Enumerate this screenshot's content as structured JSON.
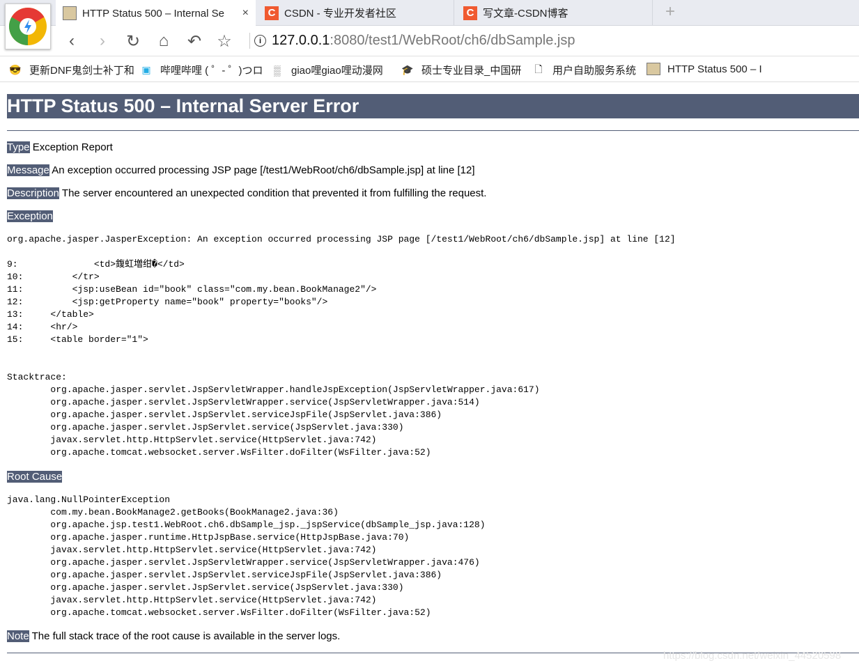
{
  "browser": {
    "tabs": [
      {
        "title": "HTTP Status 500 – Internal Se",
        "icon": "tomcat-icon",
        "active": true
      },
      {
        "title": "CSDN - 专业开发者社区",
        "icon": "csdn-icon"
      },
      {
        "title": "写文章-CSDN博客",
        "icon": "csdn-icon"
      }
    ],
    "new_tab": "+",
    "close": "×",
    "url": {
      "host": "127.0.0.1",
      "rest": ":8080/test1/WebRoot/ch6/dbSample.jsp"
    },
    "bookmarks": [
      {
        "label": "更新DNF鬼剑士补丁和"
      },
      {
        "label": "哔哩哔哩 ( ゜- ゜)つロ"
      },
      {
        "label": "giao哩giao哩动漫网"
      },
      {
        "label": "硕士专业目录_中国研"
      },
      {
        "label": "用户自助服务系统"
      },
      {
        "label": "HTTP Status 500 – I"
      }
    ]
  },
  "page": {
    "title": "HTTP Status 500 – Internal Server Error",
    "type_label": "Type",
    "type_value": " Exception Report",
    "message_label": "Message",
    "message_value": " An exception occurred processing JSP page [/test1/WebRoot/ch6/dbSample.jsp] at line [12]",
    "description_label": "Description",
    "description_value": " The server encountered an unexpected condition that prevented it from fulfilling the request.",
    "exception_label": "Exception",
    "exception_text": "org.apache.jasper.JasperException: An exception occurred processing JSP page [/test1/WebRoot/ch6/dbSample.jsp] at line [12]\n\n9:              <td>鍑虹増绀�</td>\n10:         </tr>\n11:         <jsp:useBean id=\"book\" class=\"com.my.bean.BookManage2\"/>\n12:         <jsp:getProperty name=\"book\" property=\"books\"/>\n13:     </table>\n14:     <hr/>\n15:     <table border=\"1\">\n\n\nStacktrace:\n        org.apache.jasper.servlet.JspServletWrapper.handleJspException(JspServletWrapper.java:617)\n        org.apache.jasper.servlet.JspServletWrapper.service(JspServletWrapper.java:514)\n        org.apache.jasper.servlet.JspServlet.serviceJspFile(JspServlet.java:386)\n        org.apache.jasper.servlet.JspServlet.service(JspServlet.java:330)\n        javax.servlet.http.HttpServlet.service(HttpServlet.java:742)\n        org.apache.tomcat.websocket.server.WsFilter.doFilter(WsFilter.java:52)",
    "root_cause_label": "Root Cause",
    "root_cause_text": "java.lang.NullPointerException\n        com.my.bean.BookManage2.getBooks(BookManage2.java:36)\n        org.apache.jsp.test1.WebRoot.ch6.dbSample_jsp._jspService(dbSample_jsp.java:128)\n        org.apache.jasper.runtime.HttpJspBase.service(HttpJspBase.java:70)\n        javax.servlet.http.HttpServlet.service(HttpServlet.java:742)\n        org.apache.jasper.servlet.JspServletWrapper.service(JspServletWrapper.java:476)\n        org.apache.jasper.servlet.JspServlet.serviceJspFile(JspServlet.java:386)\n        org.apache.jasper.servlet.JspServlet.service(JspServlet.java:330)\n        javax.servlet.http.HttpServlet.service(HttpServlet.java:742)\n        org.apache.tomcat.websocket.server.WsFilter.doFilter(WsFilter.java:52)",
    "note_label": "Note",
    "note_value": " The full stack trace of the root cause is available in the server logs."
  },
  "watermark": "https://blog.csdn.net/weixin_44520598",
  "colors": {
    "header_bg": "#525D76",
    "csdn": "#f05a30"
  }
}
